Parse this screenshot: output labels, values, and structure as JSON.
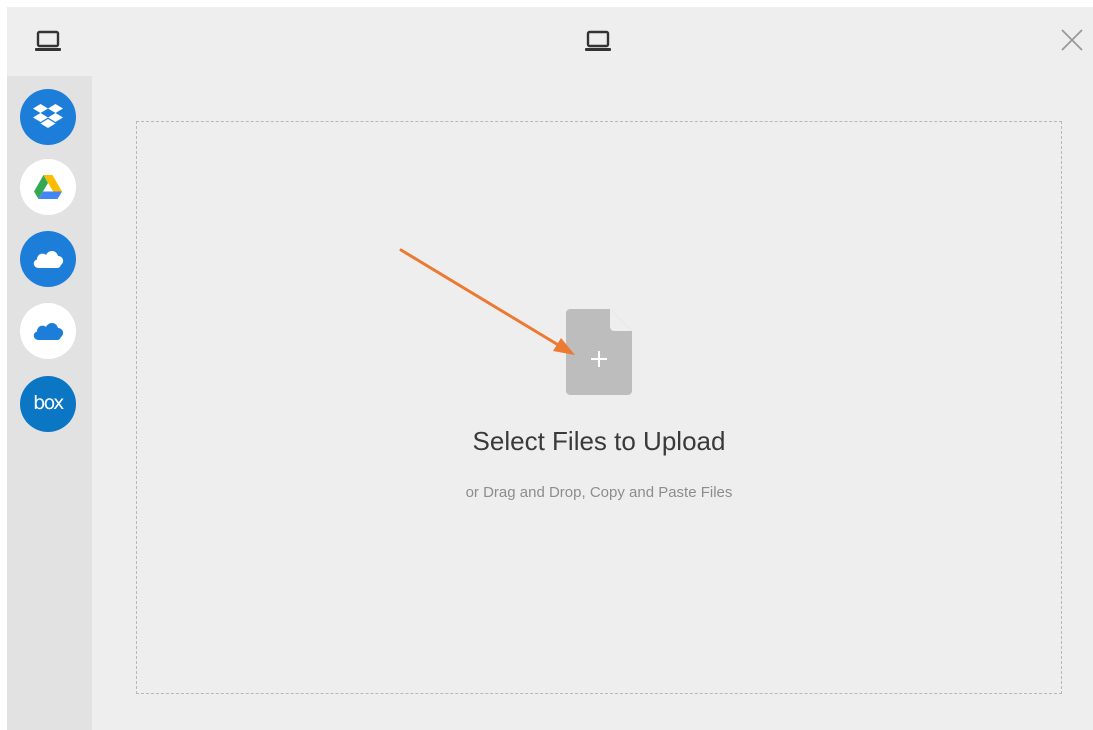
{
  "header": {
    "left_icon": "laptop-icon",
    "center_icon": "laptop-icon",
    "close_icon": "close-icon"
  },
  "sidebar": {
    "sources": [
      {
        "name": "Dropbox",
        "icon": "dropbox-icon",
        "color": "#1d7ed9"
      },
      {
        "name": "Google Drive",
        "icon": "google-drive-icon",
        "color": "#ffffff"
      },
      {
        "name": "OneDrive",
        "icon": "onedrive-icon",
        "color": "#1d7ed9"
      },
      {
        "name": "OneDrive for Business",
        "icon": "onedrive-business-icon",
        "color": "#ffffff"
      },
      {
        "name": "Box",
        "icon": "box-icon",
        "label": "box",
        "color": "#0b76c3"
      }
    ]
  },
  "dropzone": {
    "title": "Select Files to Upload",
    "subtitle": "or Drag and Drop, Copy and Paste Files",
    "icon": "file-add-icon"
  },
  "annotation": {
    "icon": "arrow-annotation",
    "color": "#ec7a33"
  },
  "colors": {
    "background": "#eeeeee",
    "sidebar": "#e2e2e2",
    "file_icon": "#bdbdbd",
    "accent_blue": "#1d7ed9"
  }
}
